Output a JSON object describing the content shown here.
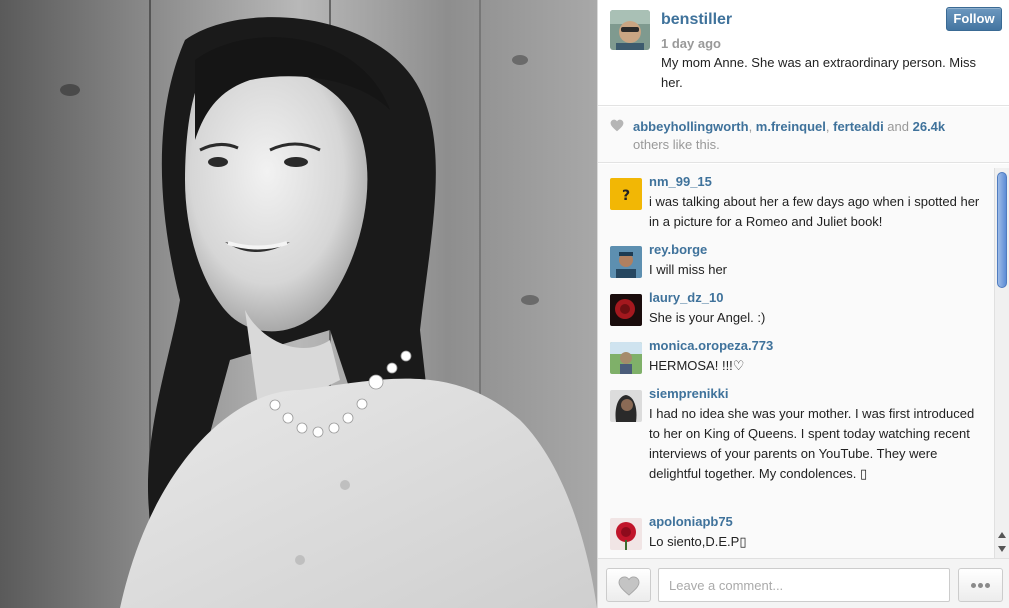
{
  "post": {
    "username": "benstiller",
    "time": "1 day ago",
    "caption": "My mom Anne. She was an extraordinary person. Miss her.",
    "follow_label": "Follow"
  },
  "likes": {
    "users": [
      "abbeyhollingworth",
      "m.freinquel",
      "fertealdi"
    ],
    "sep1": ", ",
    "sep2": ", ",
    "and_text": " and ",
    "count": "26.4k",
    "suffix": " others like this."
  },
  "comments": [
    {
      "user": "nm_99_15",
      "text": "i was talking about her a few days ago when i spotted her in a picture for a Romeo and Juliet book!",
      "avatar": "yellow-avatar"
    },
    {
      "user": "rey.borge",
      "text": "I will miss her",
      "avatar": "person-avatar"
    },
    {
      "user": "laury_dz_10",
      "text": "She is your Angel. :)",
      "avatar": "rose-avatar"
    },
    {
      "user": "monica.oropeza.773",
      "text": "HERMOSA! !!!♡",
      "avatar": "landscape-avatar"
    },
    {
      "user": "siemprenikki",
      "text": "I had no idea she was your mother. I was first introduced to her on King of Queens. I spent today watching recent interviews of your parents on YouTube. They were delightful together. My condolences. ▯",
      "avatar": "portrait-avatar"
    },
    {
      "user": "apoloniapb75",
      "text": "Lo siento,D.E.P▯",
      "avatar": "red-rose-avatar"
    }
  ],
  "footer": {
    "comment_placeholder": "Leave a comment..."
  },
  "colors": {
    "link": "#3f729b",
    "follow_button": "#4f83b3",
    "muted": "#999999"
  }
}
